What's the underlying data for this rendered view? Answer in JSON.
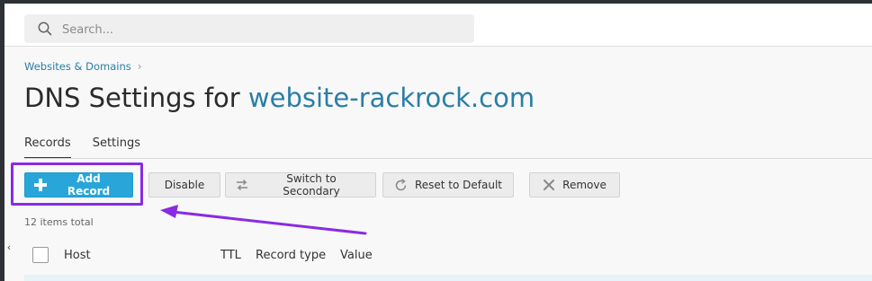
{
  "search": {
    "placeholder": "Search..."
  },
  "breadcrumb": {
    "item": "Websites & Domains",
    "separator": "›"
  },
  "page": {
    "title_prefix": "DNS Settings for ",
    "domain": "website-rackrock.com"
  },
  "tabs": [
    {
      "label": "Records",
      "active": true
    },
    {
      "label": "Settings",
      "active": false
    }
  ],
  "toolbar": {
    "add_record": "Add Record",
    "disable": "Disable",
    "switch_secondary": "Switch to Secondary",
    "reset_default": "Reset to Default",
    "remove": "Remove"
  },
  "list": {
    "items_total": "12 items total"
  },
  "table": {
    "columns": [
      "Host",
      "TTL",
      "Record type",
      "Value"
    ]
  },
  "colors": {
    "accent": "#28a6da",
    "link": "#2a7ea6",
    "highlight": "#8a2be2"
  },
  "icons": [
    "search-icon",
    "plus-icon",
    "switch-icon",
    "reset-icon",
    "remove-icon",
    "chevron-left-icon"
  ]
}
